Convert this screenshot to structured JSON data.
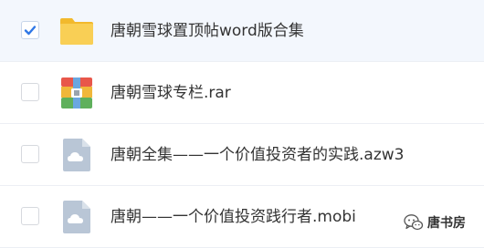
{
  "files": [
    {
      "name": "唐朝雪球置顶帖word版合集",
      "type": "folder",
      "checked": true
    },
    {
      "name": "唐朝雪球专栏.rar",
      "type": "archive",
      "checked": false
    },
    {
      "name": "唐朝全集——一个价值投资者的实践.azw3",
      "type": "document",
      "checked": false
    },
    {
      "name": "唐朝——一个价值投资践行者.mobi",
      "type": "document",
      "checked": false
    }
  ],
  "watermark": {
    "text": "唐书房",
    "icon": "wechat-icon"
  },
  "colors": {
    "check_accent": "#2f77e6",
    "folder": "#f9cf55",
    "doc_icon": "#b9c6d6",
    "selected_row": "#f3f7fd"
  }
}
